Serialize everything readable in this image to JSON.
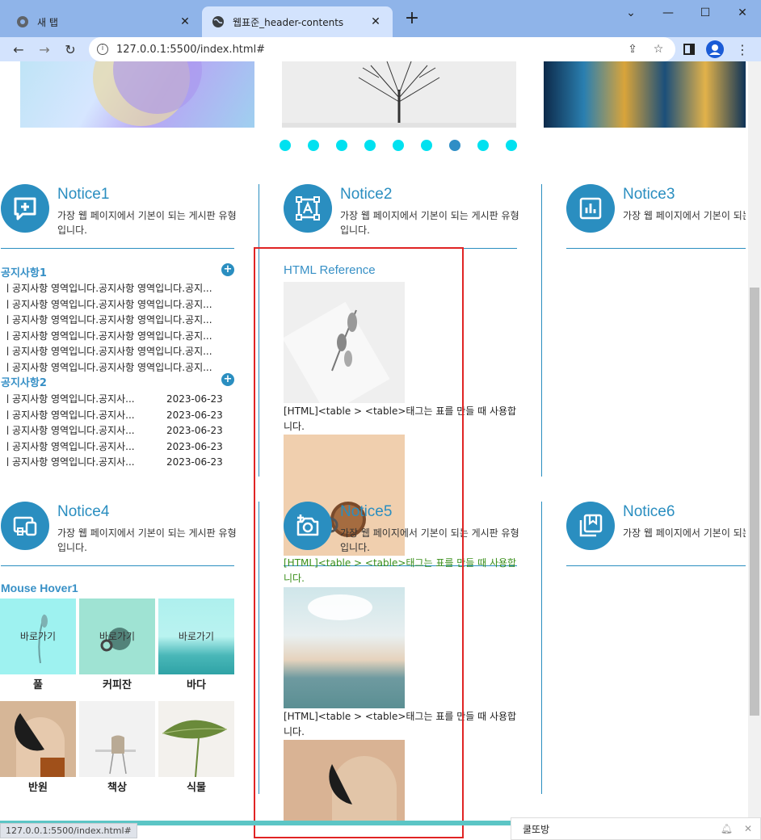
{
  "browser": {
    "tabs": [
      {
        "title": "새 탭",
        "active": false
      },
      {
        "title": "웹표준_header-contents",
        "active": true
      }
    ],
    "url": "127.0.0.1:5500/index.html#",
    "status_url": "127.0.0.1:5500/index.html#"
  },
  "slider": {
    "dot_count": 9,
    "active_dot_index": 6
  },
  "notices": [
    {
      "title": "Notice1",
      "desc": "가장 웹 페이지에서 기본이 되는 게시판 유형입니다.",
      "icon": "message-plus-icon"
    },
    {
      "title": "Notice2",
      "desc": "가장 웹 페이지에서 기본이 되는 게시판 유형입니다.",
      "icon": "text-box-icon"
    },
    {
      "title": "Notice3",
      "desc": "가장 웹 페이지에서 기본이 되는 게시판 유형입니다.",
      "icon": "bar-chart-icon"
    },
    {
      "title": "Notice4",
      "desc": "가장 웹 페이지에서 기본이 되는 게시판 유형입니다.",
      "icon": "devices-icon"
    },
    {
      "title": "Notice5",
      "desc": "가장 웹 페이지에서 기본이 되는 게시판 유형입니다.",
      "icon": "camera-plus-icon"
    },
    {
      "title": "Notice6",
      "desc": "가장 웹 페이지에서 기본이 되는 게시판 유형입니다.",
      "icon": "bookmark-collection-icon"
    }
  ],
  "board1": {
    "title": "공지사항1",
    "items": [
      "공지사항 영역입니다.공지사항 영역입니다.공지...",
      "공지사항 영역입니다.공지사항 영역입니다.공지...",
      "공지사항 영역입니다.공지사항 영역입니다.공지...",
      "공지사항 영역입니다.공지사항 영역입니다.공지...",
      "공지사항 영역입니다.공지사항 영역입니다.공지...",
      "공지사항 영역입니다.공지사항 영역입니다.공지..."
    ]
  },
  "board2": {
    "title": "공지사항2",
    "items": [
      {
        "text": "공지사항 영역입니다.공지사...",
        "date": "2023-06-23"
      },
      {
        "text": "공지사항 영역입니다.공지사...",
        "date": "2023-06-23"
      },
      {
        "text": "공지사항 영역입니다.공지사...",
        "date": "2023-06-23"
      },
      {
        "text": "공지사항 영역입니다.공지사...",
        "date": "2023-06-23"
      },
      {
        "text": "공지사항 영역입니다.공지사...",
        "date": "2023-06-23"
      }
    ]
  },
  "reference": {
    "title": "HTML Reference",
    "caption": "[HTML]<table > <table>태그는 표를 만들 때 사용합니다."
  },
  "hover": {
    "title": "Mouse Hover1",
    "goto_label": "바로가기",
    "items": [
      "풀",
      "커피잔",
      "바다",
      "반원",
      "책상",
      "식물"
    ]
  },
  "toast": {
    "text": "쿨또방"
  },
  "colors": {
    "accent": "#2a8ec0",
    "dot": "#00e1f0",
    "dot_active": "#2f8ec6",
    "highlight_box": "#e02424"
  }
}
